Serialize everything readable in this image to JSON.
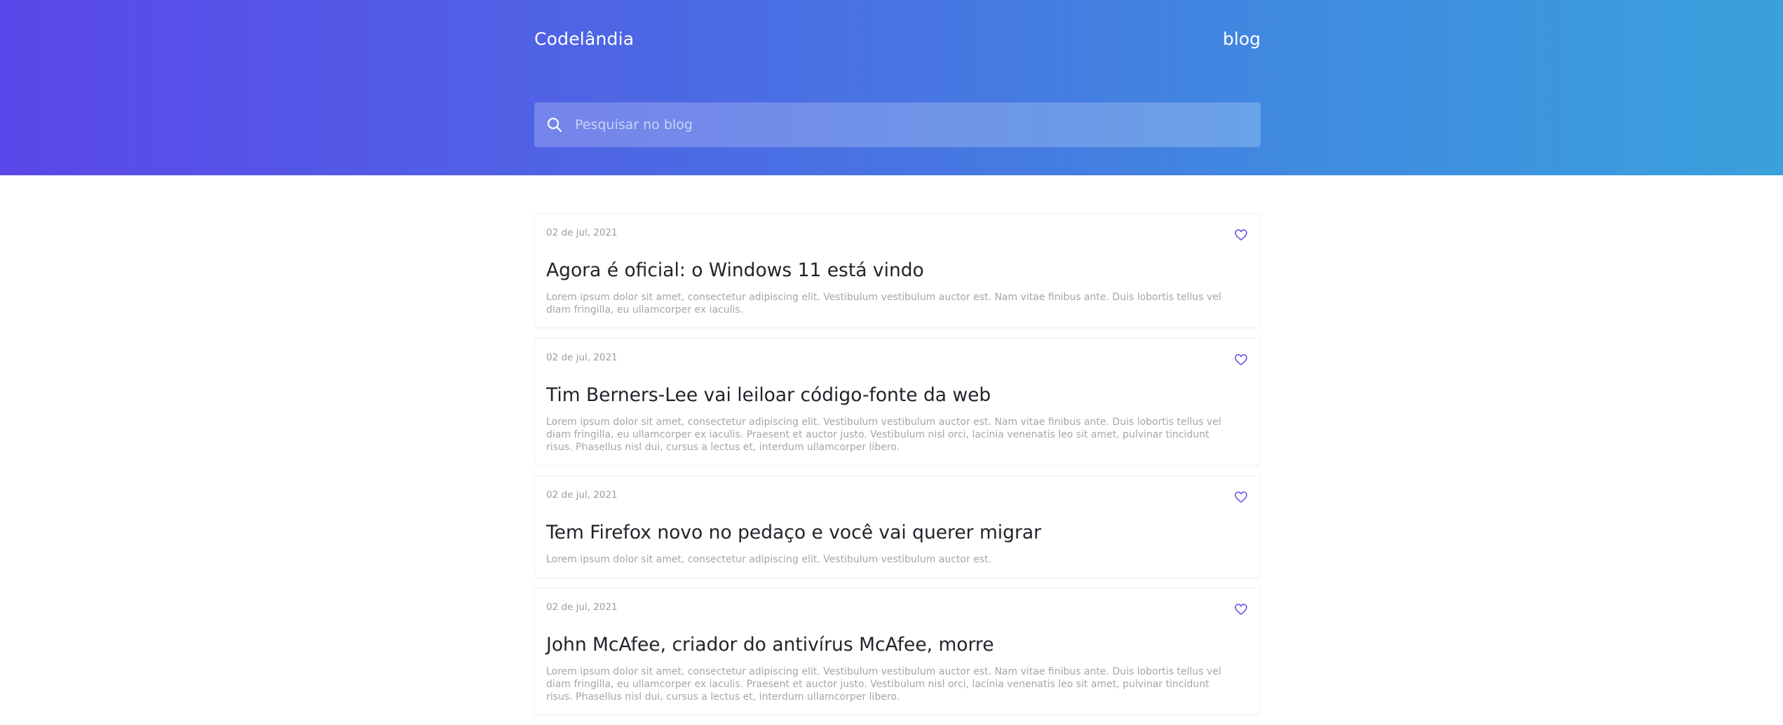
{
  "header": {
    "brand": "Codelândia",
    "nav_link": "blog",
    "search": {
      "placeholder": "Pesquisar no blog",
      "value": "",
      "icon": "search-icon"
    },
    "gradient": [
      "#5a47e9",
      "#3aa1dc"
    ]
  },
  "posts": [
    {
      "date": "02 de jul, 2021",
      "title": "Agora é oficial: o Windows 11 está vindo",
      "excerpt": "Lorem ipsum dolor sit amet, consectetur adipiscing elit. Vestibulum vestibulum auctor est. Nam vitae finibus ante. Duis lobortis tellus vel diam fringilla, eu ullamcorper ex iaculis.",
      "icon": "heart-icon"
    },
    {
      "date": "02 de jul, 2021",
      "title": "Tim Berners-Lee vai leiloar código-fonte da web",
      "excerpt": "Lorem ipsum dolor sit amet, consectetur adipiscing elit. Vestibulum vestibulum auctor est. Nam vitae finibus ante. Duis lobortis tellus vel diam fringilla, eu ullamcorper ex iaculis. Praesent et auctor justo. Vestibulum nisl orci, lacinia venenatis leo sit amet, pulvinar tincidunt risus. Phasellus nisl dui, cursus a lectus et, interdum ullamcorper libero.",
      "icon": "heart-icon"
    },
    {
      "date": "02 de jul, 2021",
      "title": "Tem Firefox novo no pedaço e você vai querer migrar",
      "excerpt": "Lorem ipsum dolor sit amet, consectetur adipiscing elit. Vestibulum vestibulum auctor est.",
      "icon": "heart-icon"
    },
    {
      "date": "02 de jul, 2021",
      "title": "John McAfee, criador do antivírus McAfee, morre",
      "excerpt": "Lorem ipsum dolor sit amet, consectetur adipiscing elit. Vestibulum vestibulum auctor est. Nam vitae finibus ante. Duis lobortis tellus vel diam fringilla, eu ullamcorper ex iaculis. Praesent et auctor justo. Vestibulum nisl orci, lacinia venenatis leo sit amet, pulvinar tincidunt risus. Phasellus nisl dui, cursus a lectus et, interdum ullamcorper libero.",
      "icon": "heart-icon"
    }
  ],
  "colors": {
    "accent": "#5a47e9",
    "title": "#23232b",
    "muted": "#a4a6ae"
  }
}
